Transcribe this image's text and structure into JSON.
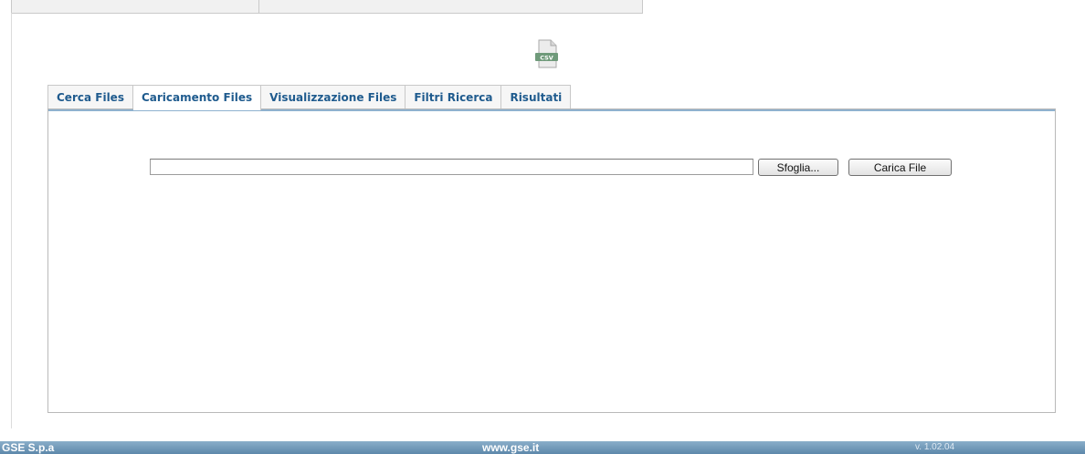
{
  "tabs": [
    {
      "label": "Cerca Files",
      "active": false
    },
    {
      "label": "Caricamento Files",
      "active": true
    },
    {
      "label": "Visualizzazione Files",
      "active": false
    },
    {
      "label": "Filtri Ricerca",
      "active": false
    },
    {
      "label": "Risultati",
      "active": false
    }
  ],
  "csv_icon": {
    "label": "CSV",
    "icon": "csv-file-icon"
  },
  "upload": {
    "file_value": "",
    "browse_label": "Sfoglia...",
    "upload_label": "Carica File"
  },
  "footer": {
    "left": "GSE S.p.a",
    "center": "www.gse.it",
    "right": "v. 1.02.04"
  },
  "colors": {
    "tab_text": "#1f5b8e",
    "panel_accent": "#8fb2cf",
    "footer_bar": "#6b93b5"
  }
}
